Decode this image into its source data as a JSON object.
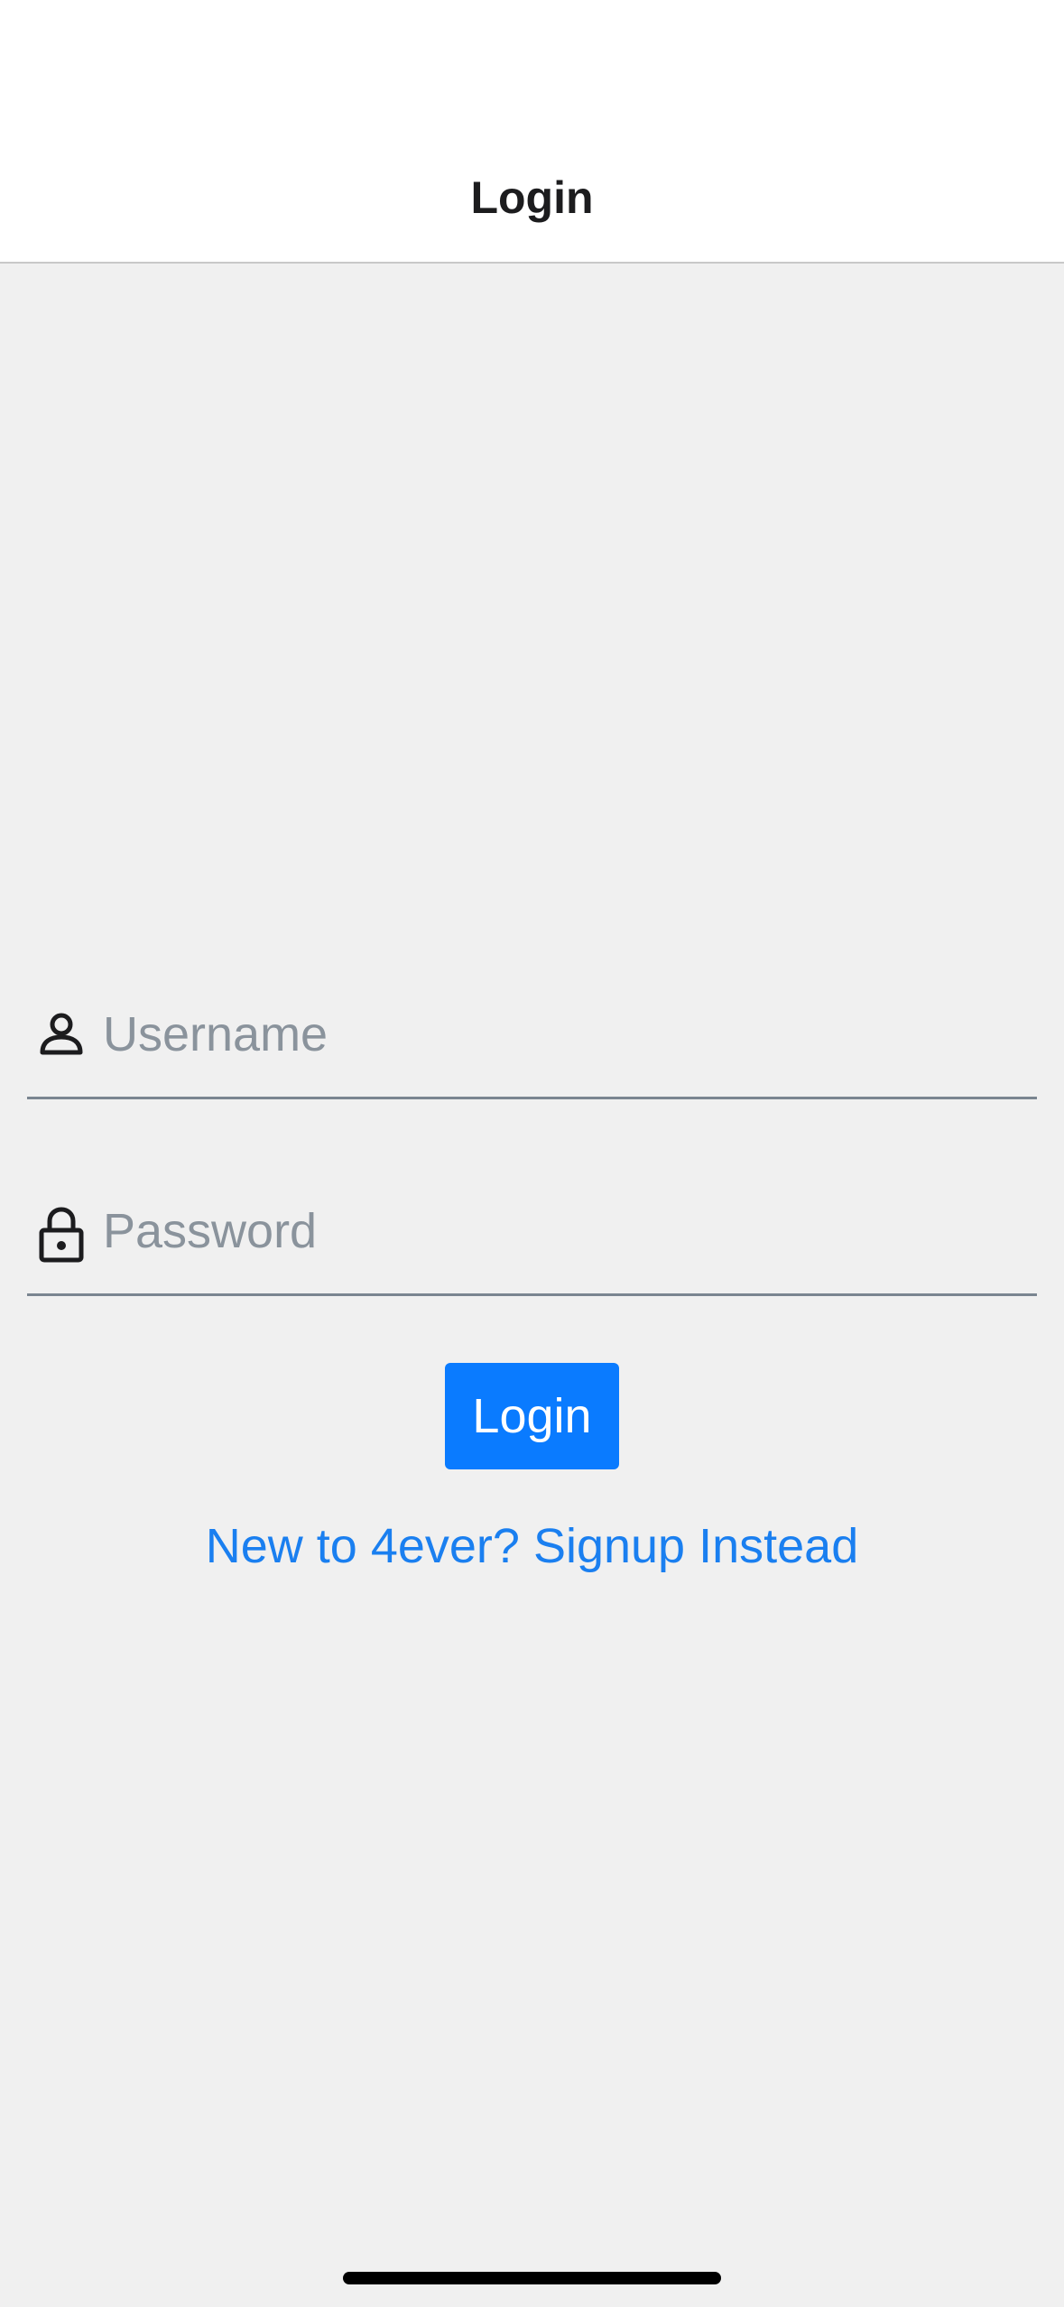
{
  "nav": {
    "title": "Login"
  },
  "form": {
    "username": {
      "icon": "person-icon",
      "value": "",
      "placeholder": "Username"
    },
    "password": {
      "icon": "lock-icon",
      "value": "",
      "placeholder": "Password"
    },
    "login_label": "Login",
    "signup_link": "New to 4ever? Signup Instead"
  },
  "colors": {
    "accent": "#0a7bff",
    "link": "#1a7ff0",
    "background": "#f0f0f0",
    "header": "#ffffff",
    "placeholder": "#8a939c",
    "underline": "#7a8590"
  }
}
